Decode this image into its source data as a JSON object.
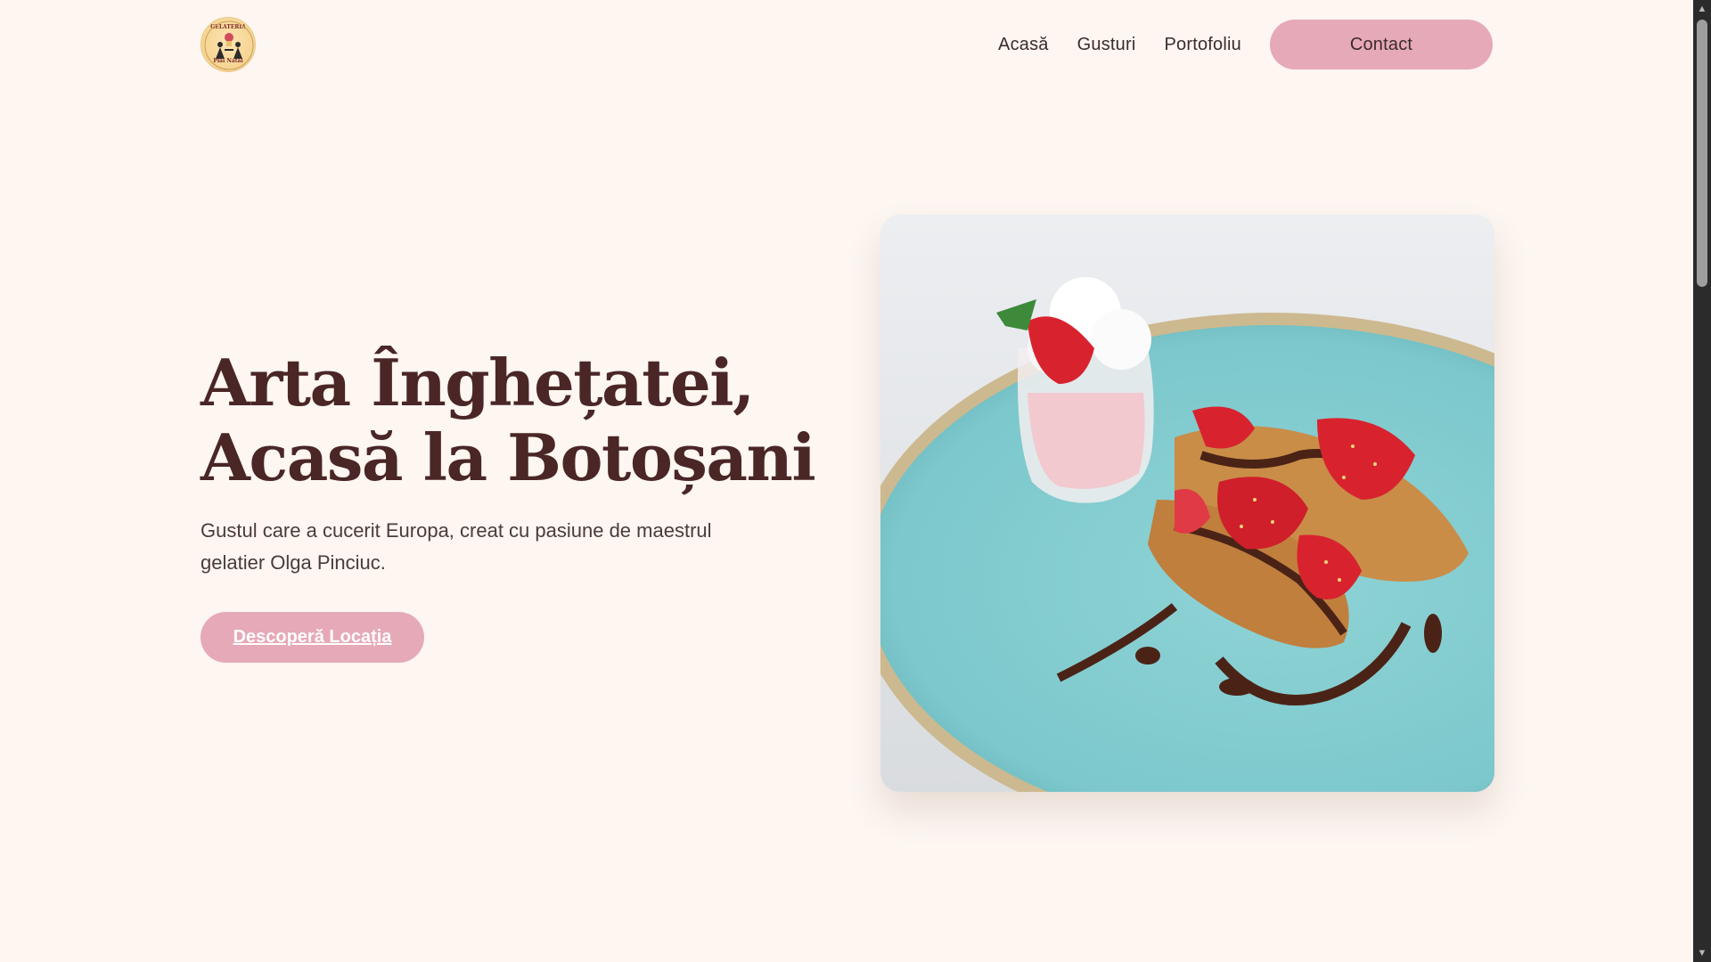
{
  "logo": {
    "top_text": "GELATERIA",
    "bottom_text": "Plai Natal"
  },
  "nav": {
    "items": [
      "Acasă",
      "Gusturi",
      "Portofoliu"
    ],
    "contact_label": "Contact"
  },
  "hero": {
    "title_line1": "Arta Înghețatei,",
    "title_line2": "Acasă la Botoșani",
    "subtitle": "Gustul care a cucerit Europa, creat cu pasiune de maestrul gelatier Olga Pinciuc.",
    "cta_label": "Descoperă Locația"
  },
  "colors": {
    "background": "#fdf6f1",
    "accent": "#e6a9b8",
    "heading": "#4a2626",
    "text": "#3c2b2b"
  }
}
